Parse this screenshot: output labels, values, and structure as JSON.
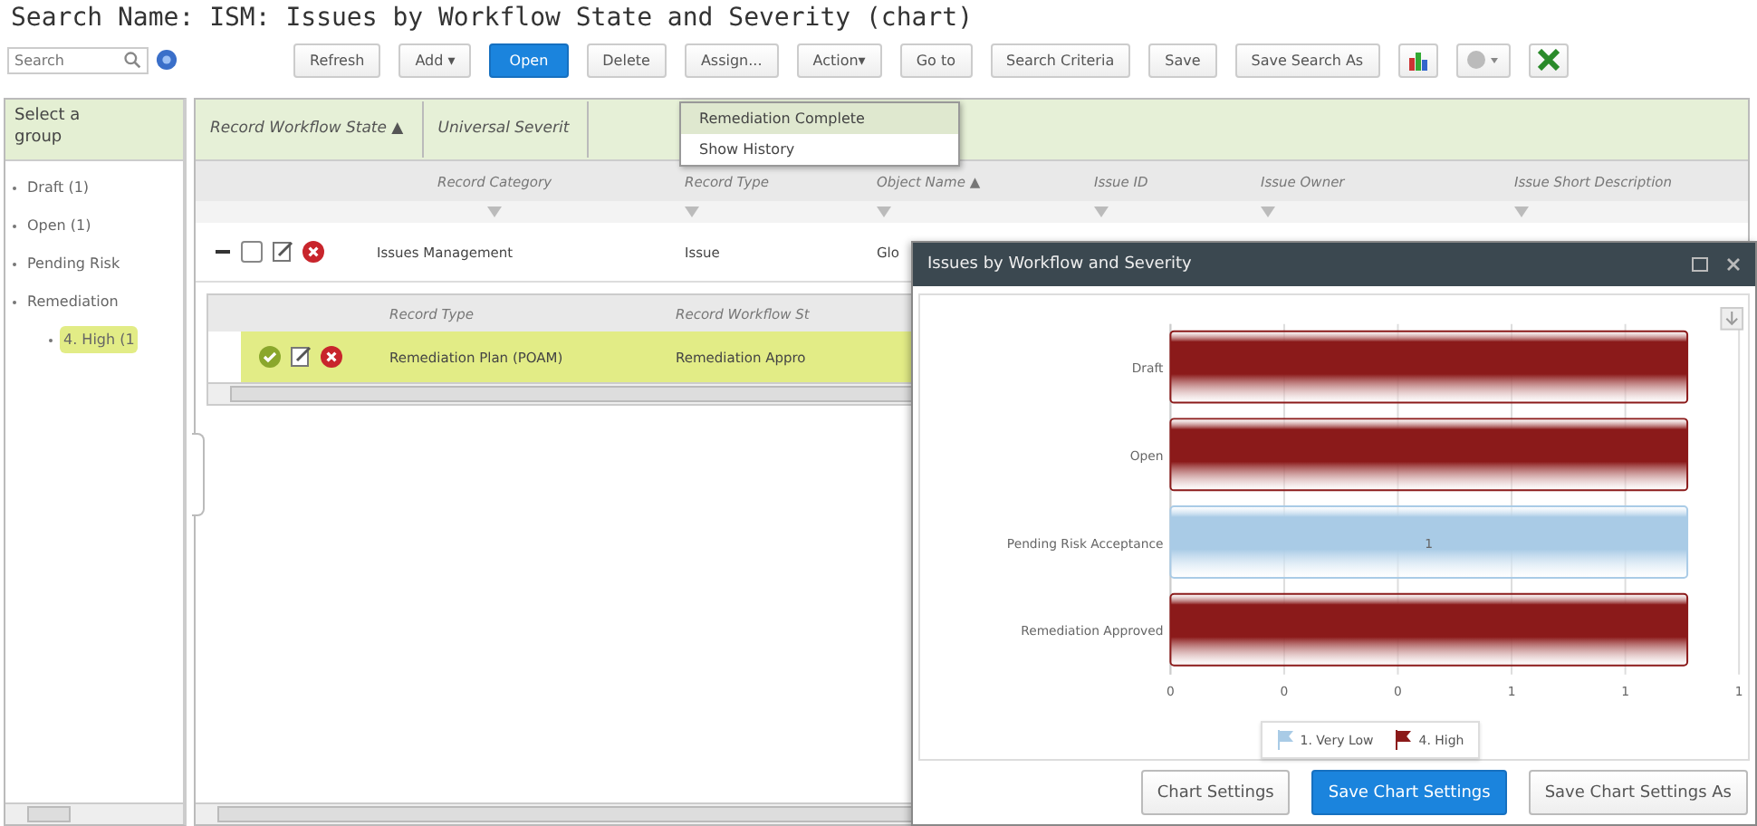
{
  "window": {
    "title": "Search Name: ISM: Issues by Workflow State and Severity (chart)"
  },
  "search": {
    "placeholder": "Search"
  },
  "toolbar": [
    {
      "label": "Refresh",
      "kind": "button",
      "primary": false
    },
    {
      "label": "Add ▾",
      "kind": "button",
      "primary": false
    },
    {
      "label": "Open",
      "kind": "button",
      "primary": true
    },
    {
      "label": "Delete",
      "kind": "button",
      "primary": false
    },
    {
      "label": "Assign...",
      "kind": "button",
      "primary": false
    },
    {
      "label": "Action▾",
      "kind": "button",
      "primary": false
    },
    {
      "label": "Go to",
      "kind": "button",
      "primary": false
    },
    {
      "label": "Search Criteria",
      "kind": "button",
      "primary": false
    },
    {
      "label": "Save",
      "kind": "button",
      "primary": false
    },
    {
      "label": "Save Search As",
      "kind": "button",
      "primary": false
    },
    {
      "kind": "chart"
    },
    {
      "kind": "gear"
    },
    {
      "kind": "excel"
    }
  ],
  "action_menu": [
    {
      "label": "Remediation Complete",
      "selected": true
    },
    {
      "label": "Show History",
      "selected": false
    }
  ],
  "sidebar": {
    "title": "Select a group",
    "items": [
      {
        "label": "Draft (1)",
        "selected": false
      },
      {
        "label": "Open (1)",
        "selected": false
      },
      {
        "label": "Pending Risk",
        "selected": false
      },
      {
        "label": "Remediation",
        "selected": false,
        "children": [
          {
            "label": "4. High (1",
            "selected": true
          }
        ]
      }
    ]
  },
  "breadcrumb": [
    "Record Workflow State ▲",
    "Universal Severit"
  ],
  "table": {
    "columns": [
      "Record Category",
      "Record Type",
      "Object Name ▲",
      "Issue ID",
      "Issue Owner",
      "Issue Short Description"
    ],
    "rows": [
      {
        "expanded": true,
        "checked": false,
        "cells": [
          "Issues Management",
          "Issue",
          "Glo"
        ]
      }
    ]
  },
  "subtable": {
    "columns": [
      "Record Type",
      "Record Workflow St"
    ],
    "rows": [
      {
        "selected": true,
        "cells": [
          "Remediation Plan (POAM)",
          "Remediation Appro"
        ]
      }
    ]
  },
  "chart_window": {
    "title": "Issues by Workflow and Severity",
    "chart_data": {
      "type": "bar",
      "orientation": "horizontal",
      "stacked": true,
      "grid": true,
      "categories": [
        "Draft",
        "Open",
        "Pending Risk Acceptance",
        "Remediation Approved"
      ],
      "series": [
        {
          "name": "1. Very Low",
          "color": "#a9cbe6",
          "values": [
            null,
            null,
            1,
            null
          ]
        },
        {
          "name": "4. High",
          "color": "#8b1a1a",
          "values": [
            1,
            1,
            null,
            1
          ]
        }
      ],
      "xlim": [
        0,
        1.1
      ],
      "xticks": [
        {
          "value": 0,
          "label": "0"
        },
        {
          "value": 0.22,
          "label": "0"
        },
        {
          "value": 0.44,
          "label": "0"
        },
        {
          "value": 0.66,
          "label": "1"
        },
        {
          "value": 0.88,
          "label": "1"
        },
        {
          "value": 1.1,
          "label": "1"
        }
      ],
      "annotations": [
        {
          "text": "1",
          "x": 0.5,
          "y": "Pending Risk Acceptance"
        }
      ]
    },
    "buttons": [
      {
        "label": "Chart Settings",
        "primary": false
      },
      {
        "label": "Save Chart Settings",
        "primary": true
      },
      {
        "label": "Save Chart Settings As",
        "primary": false
      }
    ]
  }
}
